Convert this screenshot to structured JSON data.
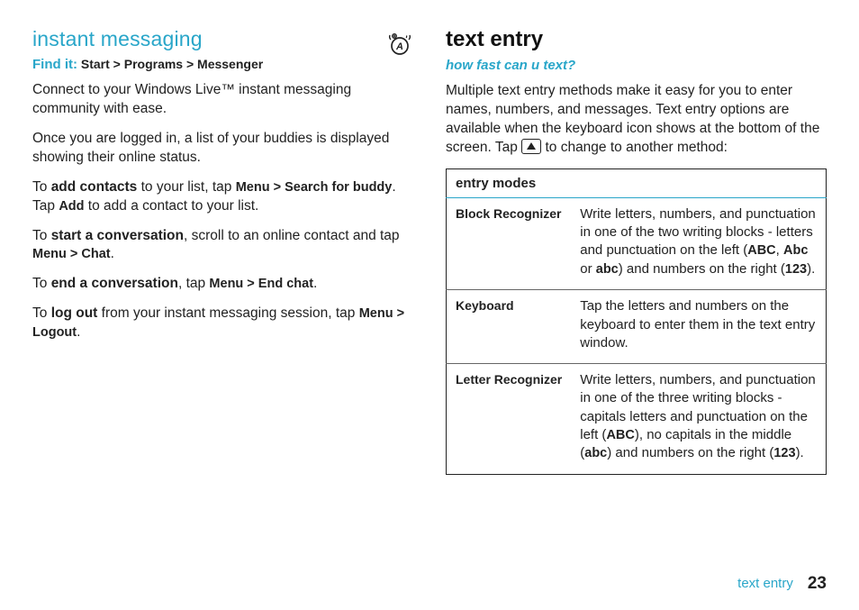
{
  "left": {
    "heading": "instant messaging",
    "find_it_label": "Find it:",
    "find_it_path": " Start > Programs > Messenger",
    "p1": "Connect to your Windows Live™ instant messaging community with ease.",
    "p2": "Once you are logged in, a list of your buddies is displayed showing their online status.",
    "p3_a": "To ",
    "p3_b": "add contacts",
    "p3_c": " to your list, tap ",
    "p3_d": "Menu > Search for buddy",
    "p3_e": ". Tap ",
    "p3_f": "Add",
    "p3_g": " to add a contact to your list.",
    "p4_a": "To ",
    "p4_b": "start a conversation",
    "p4_c": ", scroll to an online contact and tap ",
    "p4_d": "Menu > Chat",
    "p4_e": ".",
    "p5_a": "To ",
    "p5_b": "end a conversation",
    "p5_c": ", tap ",
    "p5_d": "Menu > End chat",
    "p5_e": ".",
    "p6_a": "To ",
    "p6_b": "log out",
    "p6_c": " from your instant messaging session, tap ",
    "p6_d": "Menu > Logout",
    "p6_e": "."
  },
  "right": {
    "heading": "text entry",
    "subhead": "how fast can u text?",
    "p1_a": "Multiple text entry methods make it easy for you to enter names, numbers, and messages. Text entry options are available when the keyboard icon shows at the bottom of the screen. Tap ",
    "p1_b": " to change to another method:",
    "table_header": "entry modes",
    "rows": [
      {
        "name": "Block Recognizer",
        "d1": "Write letters, numbers, and punctuation in one of the two writing blocks - letters and punctuation on the left (",
        "d2": "ABC",
        "d3": ", ",
        "d4": "Abc",
        "d5": " or ",
        "d6": "abc",
        "d7": ") and numbers on the right (",
        "d8": "123",
        "d9": ")."
      },
      {
        "name": "Keyboard",
        "d1": "Tap the letters and numbers on the keyboard to enter them in the text entry window."
      },
      {
        "name": "Letter Recognizer",
        "d1": "Write letters, numbers, and punctuation in one of the three writing blocks - capitals letters and punctuation on the left (",
        "d2": "ABC",
        "d3": "), no capitals in the middle (",
        "d4": "abc",
        "d5": ") and numbers on the right (",
        "d6": "123",
        "d7": ")."
      }
    ]
  },
  "footer": {
    "section": "text entry",
    "page": "23"
  }
}
